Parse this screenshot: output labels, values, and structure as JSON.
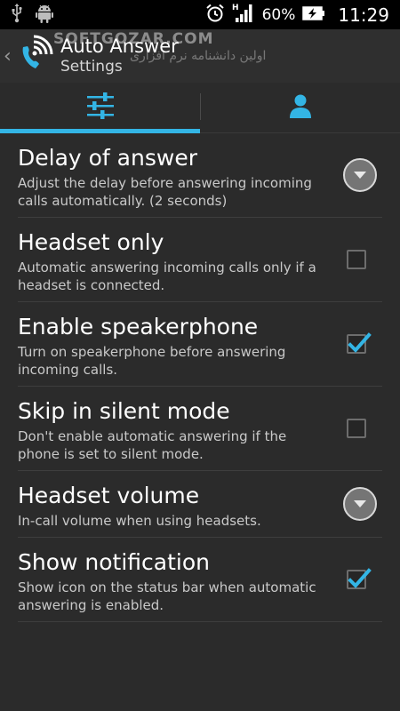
{
  "status_bar": {
    "battery_percent": "60%",
    "time": "11:29",
    "network_type": "H"
  },
  "action_bar": {
    "title": "Auto Answer",
    "subtitle": "Settings",
    "watermark": "SOFTGOZAR.COM",
    "watermark_fa": "اولین دانشنامه نرم افزاری"
  },
  "tabs": [
    {
      "icon": "sliders-icon",
      "active": true
    },
    {
      "icon": "person-icon",
      "active": false
    }
  ],
  "preferences": [
    {
      "title": "Delay of answer",
      "summary": "Adjust the delay before answering incoming calls automatically. (2 seconds)",
      "widget": "dropdown"
    },
    {
      "title": "Headset only",
      "summary": "Automatic answering incoming calls only if a headset is connected.",
      "widget": "checkbox",
      "checked": false
    },
    {
      "title": "Enable speakerphone",
      "summary": "Turn on speakerphone before answering incoming calls.",
      "widget": "checkbox",
      "checked": true
    },
    {
      "title": "Skip in silent mode",
      "summary": "Don't enable automatic answering if the phone is set to silent mode.",
      "widget": "checkbox",
      "checked": false
    },
    {
      "title": "Headset volume",
      "summary": "In-call volume when using headsets.",
      "widget": "dropdown"
    },
    {
      "title": "Show notification",
      "summary": "Show icon on the status bar when automatic answering is enabled.",
      "widget": "checkbox",
      "checked": true
    }
  ],
  "colors": {
    "accent": "#33b5e5",
    "background": "#2b2b2b",
    "status_bar": "#000000"
  }
}
